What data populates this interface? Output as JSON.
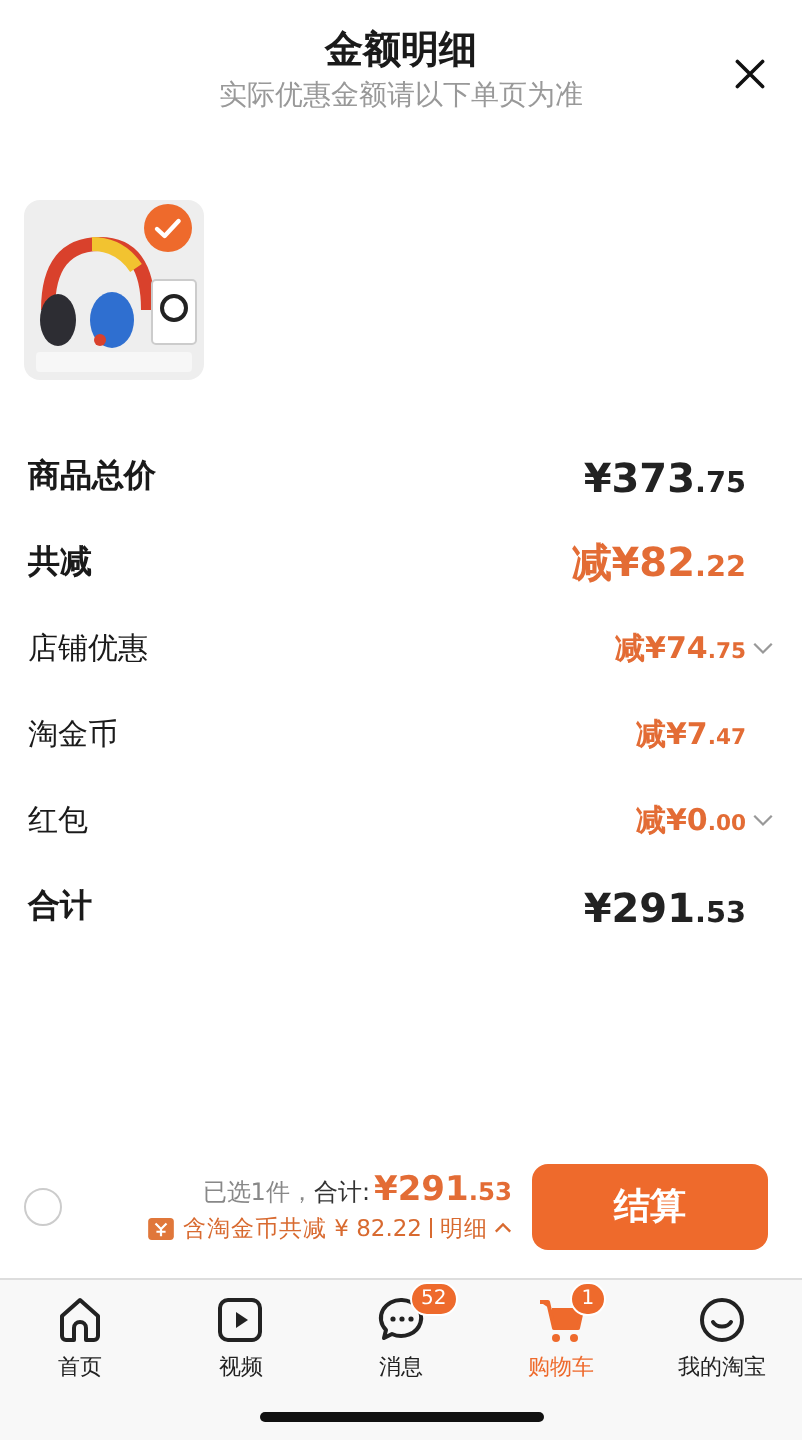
{
  "header": {
    "title": "金额明细",
    "subtitle": "实际优惠金额请以下单页为准"
  },
  "product": {
    "checked": true
  },
  "rows": [
    {
      "kind": "total",
      "label": "商品总价",
      "amount": "¥373.75",
      "expandable": false
    },
    {
      "kind": "discount",
      "label": "共减",
      "amount": "减¥82.22",
      "expandable": false
    },
    {
      "kind": "sub",
      "label": "店铺优惠",
      "amount": "减¥74.75",
      "expandable": true
    },
    {
      "kind": "sub",
      "label": "淘金币",
      "amount": "减¥7.47",
      "expandable": false
    },
    {
      "kind": "sub",
      "label": "红包",
      "amount": "减¥0.00",
      "expandable": true
    },
    {
      "kind": "total",
      "label": "合计",
      "amount": "¥291.53",
      "expandable": false
    }
  ],
  "checkout": {
    "selected": false,
    "count_text": "已选1件，",
    "total_label": "合计:",
    "total": "¥291.53",
    "saving": "含淘金币共减 ¥ 82.22",
    "detail": "明细",
    "button": "结算"
  },
  "tabs": [
    {
      "label": "首页",
      "selected": false
    },
    {
      "label": "视频",
      "selected": false
    },
    {
      "label": "消息",
      "selected": false,
      "badge": "52"
    },
    {
      "label": "购物车",
      "selected": true,
      "badge": "1"
    },
    {
      "label": "我的淘宝",
      "selected": false
    }
  ]
}
